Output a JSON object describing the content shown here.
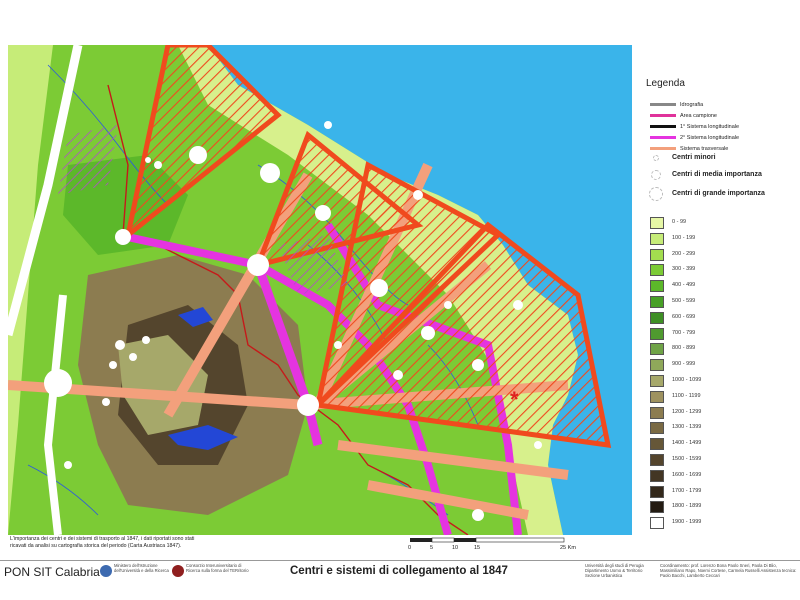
{
  "legend": {
    "title": "Legenda",
    "lines": [
      {
        "label": "Idrografia",
        "icon": "hydrography-line-icon",
        "color": "#888888"
      },
      {
        "label": "Area campione",
        "icon": "sample-area-icon",
        "color": "#e0329b"
      },
      {
        "label": "1° Sistema longitudinale",
        "icon": "longitudinal-1-icon",
        "color": "#111111"
      },
      {
        "label": "2° Sistema longitudinale",
        "icon": "longitudinal-2-icon",
        "color": "#e534e0"
      },
      {
        "label": "Sistema trasversale",
        "icon": "transversal-icon",
        "color": "#f3a07c"
      }
    ],
    "centri": [
      {
        "label": "Centri minori",
        "icon": "small-center-icon"
      },
      {
        "label": "Centri di media importanza",
        "icon": "medium-center-icon"
      },
      {
        "label": "Centri di grande importanza",
        "icon": "large-center-icon"
      }
    ],
    "elevation": [
      {
        "label": "0 - 99",
        "color": "#e6f7a6"
      },
      {
        "label": "100 - 199",
        "color": "#c6ec78"
      },
      {
        "label": "200 - 299",
        "color": "#a3dd4f"
      },
      {
        "label": "300 - 399",
        "color": "#7ccb35"
      },
      {
        "label": "400 - 499",
        "color": "#5cb82a"
      },
      {
        "label": "500 - 599",
        "color": "#48a026"
      },
      {
        "label": "600 - 699",
        "color": "#3e8f25"
      },
      {
        "label": "700 - 799",
        "color": "#4f9a2f"
      },
      {
        "label": "800 - 899",
        "color": "#6fa347"
      },
      {
        "label": "900 - 999",
        "color": "#8fa85a"
      },
      {
        "label": "1000 - 1099",
        "color": "#a6a86a"
      },
      {
        "label": "1100 - 1199",
        "color": "#9e9260"
      },
      {
        "label": "1200 - 1299",
        "color": "#8c7c50"
      },
      {
        "label": "1300 - 1399",
        "color": "#7a6a44"
      },
      {
        "label": "1400 - 1499",
        "color": "#665738"
      },
      {
        "label": "1500 - 1599",
        "color": "#54452d"
      },
      {
        "label": "1600 - 1699",
        "color": "#433624"
      },
      {
        "label": "1700 - 1799",
        "color": "#33281b"
      },
      {
        "label": "1800 - 1899",
        "color": "#231b12"
      },
      {
        "label": "1900 - 1999",
        "color": "#ffffff"
      }
    ]
  },
  "note": "L'importanza dei centri e dei sistemi di trasporto al 1847, i dati riportati sono stati ricavati da analisi su cartografia storica del periodo (Carta Austriaca 1847).",
  "scale": {
    "ticks": [
      "0",
      "5",
      "10",
      "15",
      "25 Km"
    ]
  },
  "footer": {
    "project": "PON SIT Calabria",
    "ministry": "Ministero dell'Istruzione dell'Università e della Ricerca",
    "consortium": "Consorzio Interuniversitario di Ricerca sulla forma del TERritorio",
    "title": "Centri e sistemi di collegamento al 1847",
    "university": "Università degli studi di Perugia Dipartimento Uomo & Territorio Sezione Urbanistica",
    "credits": "Coordinamento: prof. Lorenzo Bona Paolo Sneri, Paola Di Blio, Massimiliano Rapo, Noemi Cortese, Carmela Russelli Assistenza tecnica: Paolo Bacchi, Lamberto Ceccari"
  },
  "map": {
    "sea_color": "#3ab4ea",
    "hatch_color": "#f04a1e",
    "marker": "*"
  }
}
